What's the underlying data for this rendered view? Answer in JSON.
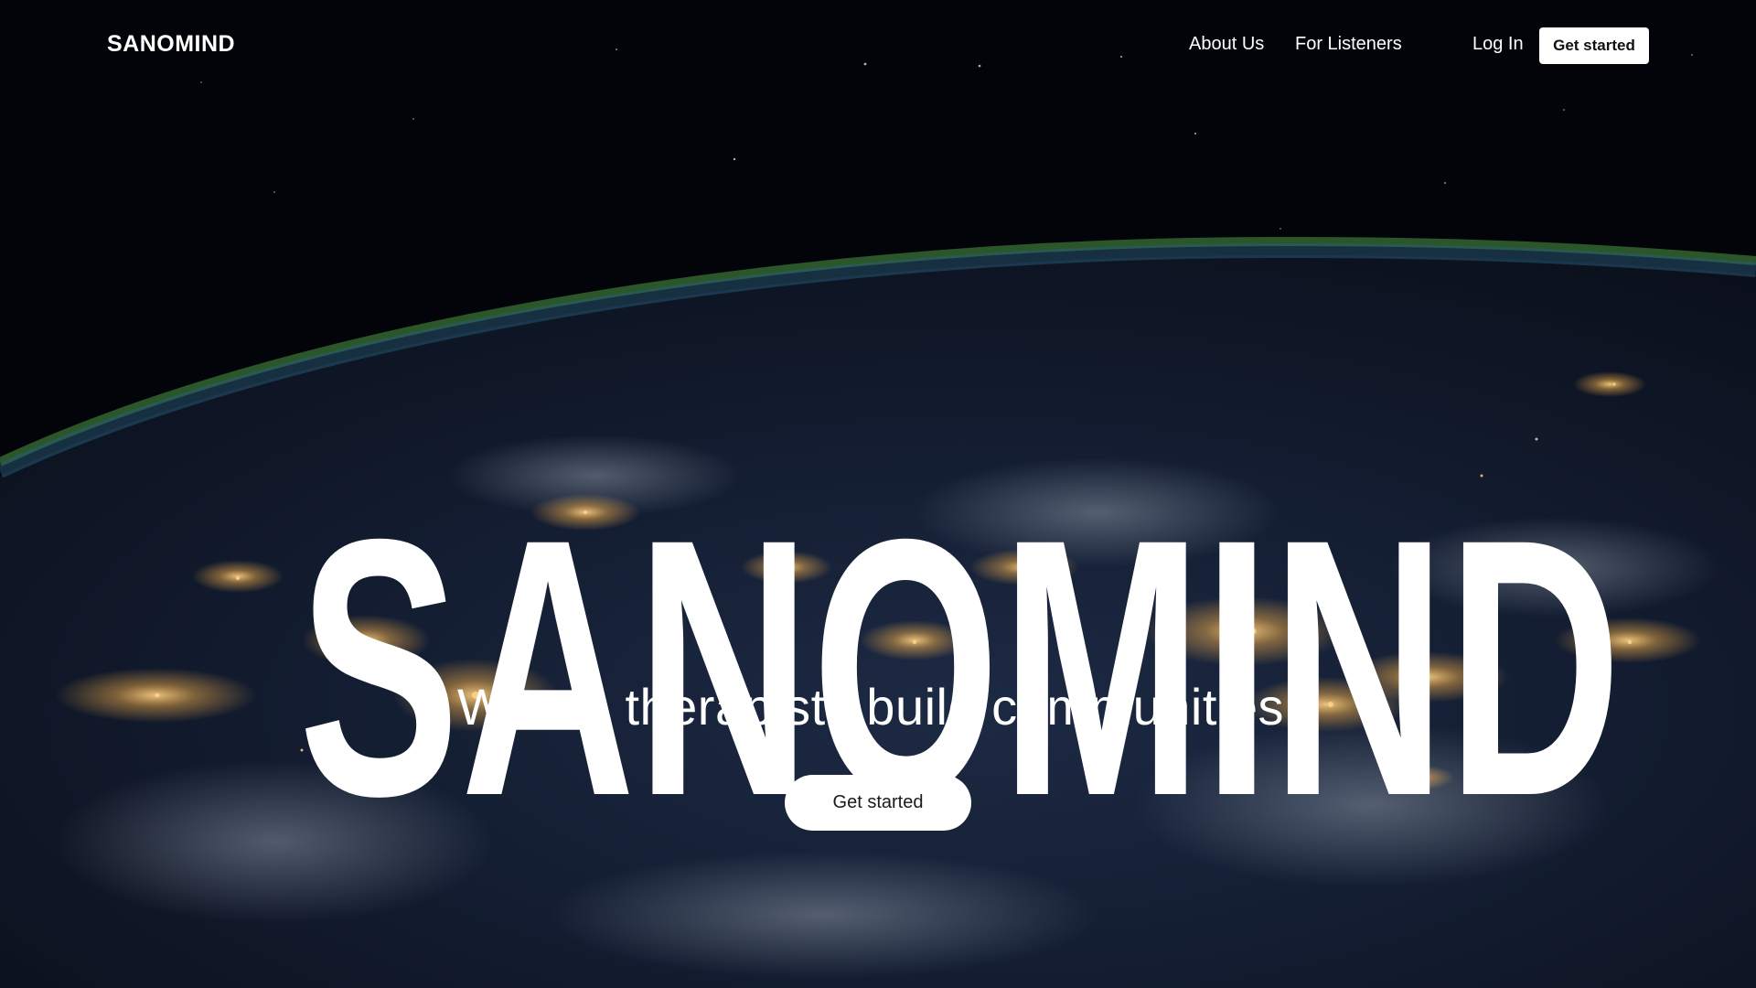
{
  "nav": {
    "brand": "SANOMIND",
    "links": [
      {
        "label": "About Us"
      },
      {
        "label": "For Listeners"
      },
      {
        "label": "Log In"
      }
    ],
    "cta_label": "Get started"
  },
  "hero": {
    "title": "SANOMIND",
    "subtitle": "Where therapists build communities.",
    "cta_label": "Get started"
  },
  "background": {
    "description_icon": "earth-at-night-from-space-image"
  },
  "colors": {
    "text": "#ffffff",
    "button_bg": "#ffffff",
    "button_text": "#111111",
    "space": "#02040a",
    "city_lights": "#ffc76b"
  }
}
